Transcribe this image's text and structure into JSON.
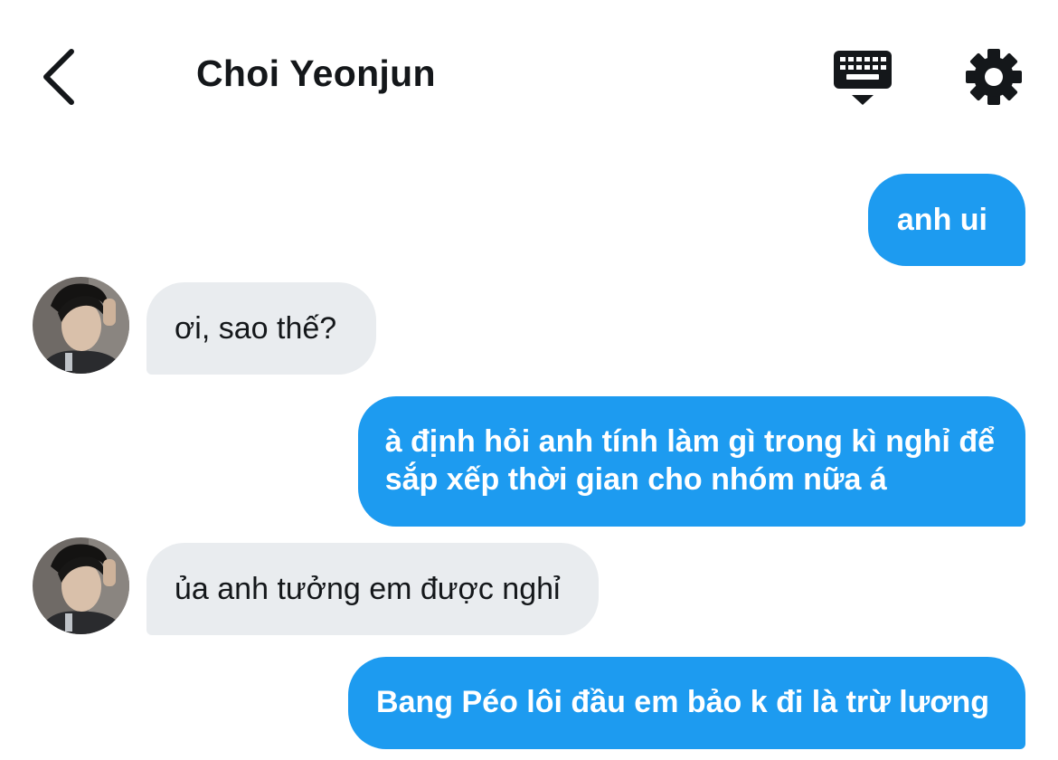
{
  "header": {
    "title": "Choi Yeonjun",
    "back_icon": "chevron-left-icon",
    "keyboard_icon": "keyboard-hide-icon",
    "settings_icon": "gear-icon"
  },
  "messages": [
    {
      "direction": "outgoing",
      "text": "anh ui"
    },
    {
      "direction": "incoming",
      "text": "ơi, sao thế?"
    },
    {
      "direction": "outgoing",
      "lines": [
        "à định hỏi anh tính làm gì trong kì nghỉ để",
        "sắp xếp thời gian cho nhóm nữa á"
      ]
    },
    {
      "direction": "incoming",
      "text": "ủa anh tưởng em được nghỉ"
    },
    {
      "direction": "outgoing",
      "text": "Bang Péo lôi đầu em bảo k đi là trừ lương"
    }
  ],
  "colors": {
    "outgoing_bubble": "#1d9bf0",
    "incoming_bubble": "#e9ecef",
    "text_dark": "#14171a"
  }
}
